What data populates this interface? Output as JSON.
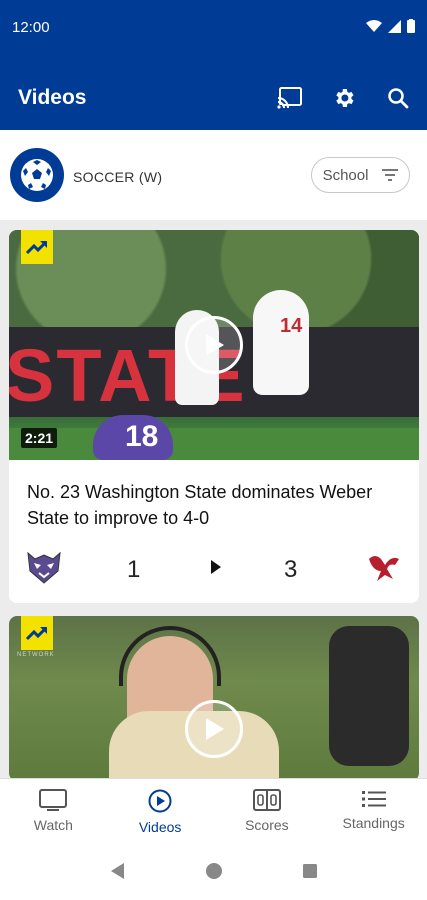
{
  "status": {
    "time": "12:00"
  },
  "appbar": {
    "title": "Videos"
  },
  "filter": {
    "sport": "SOCCER (W)",
    "school_label": "School"
  },
  "cards": [
    {
      "duration": "2:21",
      "headline": "No. 23 Washington State dominates Weber State to improve to 4-0",
      "home_score": "1",
      "away_score": "3",
      "banner_text": "STATE",
      "jersey_a": "14",
      "jersey_b": "18"
    },
    {
      "network_label": "NETWORK"
    }
  ],
  "nav": [
    {
      "label": "Watch",
      "icon": "tv-icon"
    },
    {
      "label": "Videos",
      "icon": "play-circle-icon"
    },
    {
      "label": "Scores",
      "icon": "scoreboard-icon"
    },
    {
      "label": "Standings",
      "icon": "list-icon"
    }
  ],
  "colors": {
    "brand": "#003C96",
    "trend": "#F3E100",
    "cougar_red": "#B61F2E"
  }
}
